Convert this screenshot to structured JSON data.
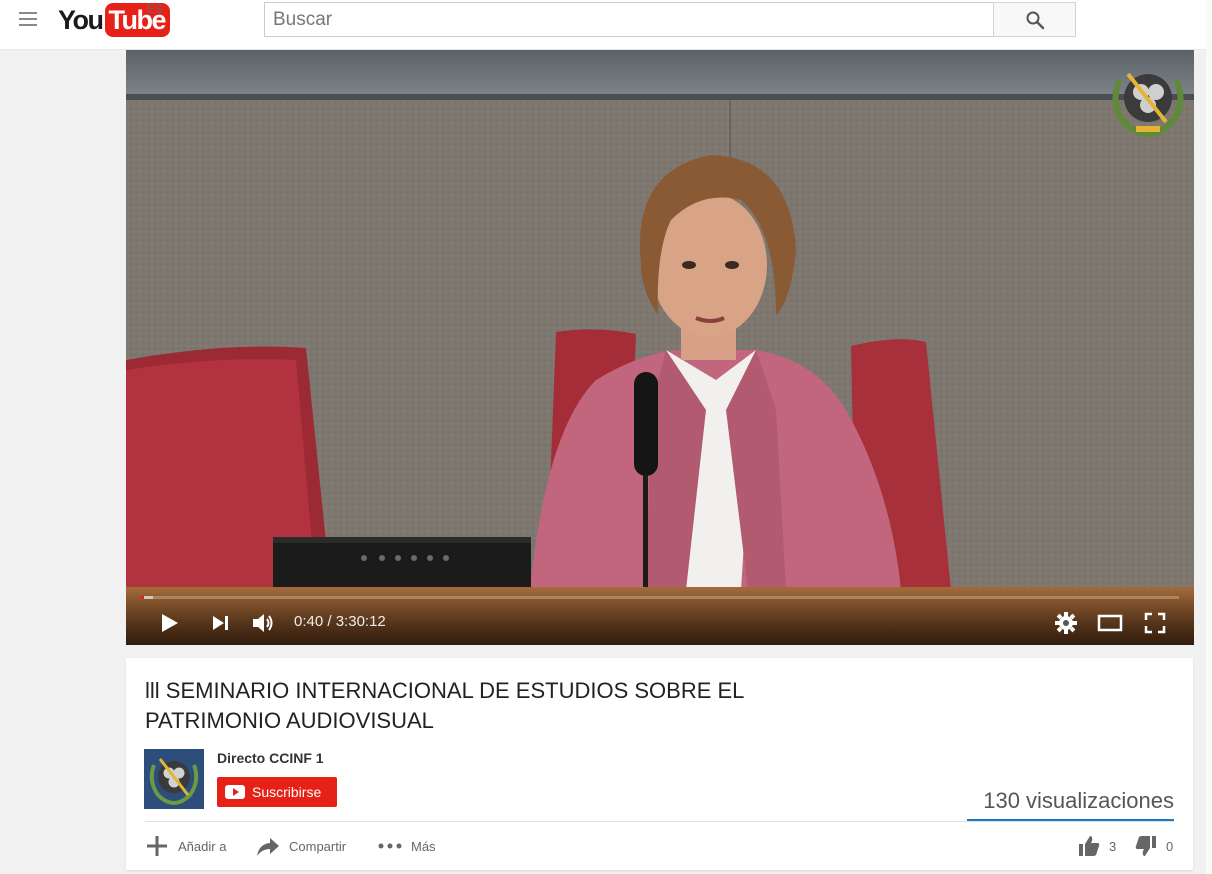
{
  "masthead": {
    "logo_you": "You",
    "logo_tube": "Tube",
    "region": "ES",
    "search_placeholder": "Buscar"
  },
  "player": {
    "current_time": "0:40",
    "duration": "3:30:12",
    "time_separator": " / ",
    "progress_played_fraction": 0.0032,
    "progress_loaded_fraction": 0.012
  },
  "video": {
    "title": "lll SEMINARIO INTERNACIONAL DE ESTUDIOS SOBRE EL PATRIMONIO AUDIOVISUAL",
    "views": "130 visualizaciones"
  },
  "channel": {
    "name": "Directo CCINF 1",
    "subscribe_label": "Suscribirse"
  },
  "actions": {
    "add_label": "Añadir a",
    "share_label": "Compartir",
    "more_label": "Más",
    "likes": "3",
    "dislikes": "0"
  },
  "colors": {
    "brand_red": "#e62117",
    "views_bar_blue": "#167ac6"
  },
  "icons": [
    "menu-icon",
    "search-icon",
    "play-icon",
    "next-icon",
    "volume-icon",
    "settings-icon",
    "theater-icon",
    "fullscreen-icon",
    "plus-icon",
    "share-icon",
    "more-icon",
    "thumbs-up-icon",
    "thumbs-down-icon"
  ]
}
